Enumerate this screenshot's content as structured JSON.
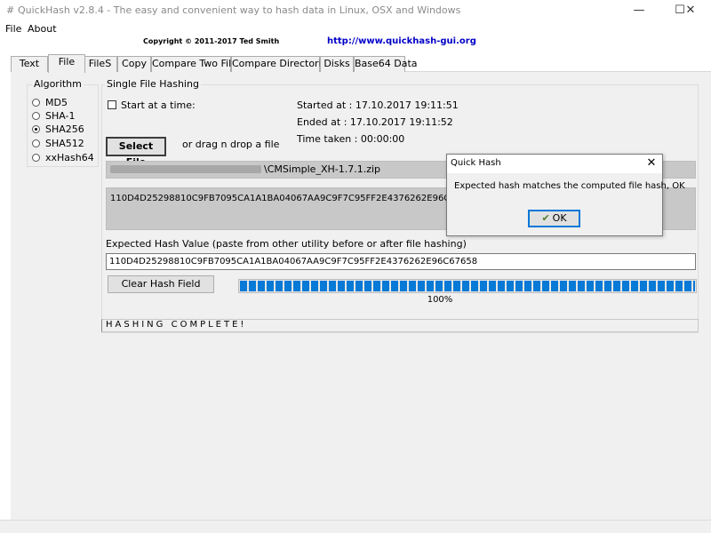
{
  "window": {
    "title": "QuickHash v2.8.4 - The easy and convenient way to hash data in Linux, OSX and Windows",
    "icon": "hash-icon",
    "minimize_glyph": "—",
    "maximize_glyph": "☐",
    "close_glyph": "✕"
  },
  "menu": {
    "items": [
      {
        "label": "File"
      },
      {
        "label": "About"
      }
    ]
  },
  "header": {
    "copyright": "Copyright © 2011-2017 Ted Smith",
    "website": "http://www.quickhash-gui.org"
  },
  "tabs": [
    {
      "label": "Text"
    },
    {
      "label": "File"
    },
    {
      "label": "FileS"
    },
    {
      "label": "Copy"
    },
    {
      "label": "Compare Two Files"
    },
    {
      "label": "Compare Directories"
    },
    {
      "label": "Disks"
    },
    {
      "label": "Base64 Data"
    }
  ],
  "active_tab": "File",
  "algorithm": {
    "legend": "Algorithm",
    "options": [
      {
        "label": "MD5",
        "checked": false
      },
      {
        "label": "SHA-1",
        "checked": false
      },
      {
        "label": "SHA256",
        "checked": true
      },
      {
        "label": "SHA512",
        "checked": false
      },
      {
        "label": "xxHash64",
        "checked": false
      }
    ]
  },
  "single_file": {
    "legend": "Single File Hashing",
    "start_at_label": "Start at a time:",
    "started_at": "Started at : 17.10.2017 19:11:51",
    "ended_at": "Ended at   : 17.10.2017 19:11:52",
    "time_taken": "Time taken : 00:00:00",
    "select_file_label": "Select File",
    "drag_text": "or drag n drop a file",
    "file_path_visible": "\\CMSimple_XH-1.7.1.zip",
    "computed_hash": "110D4D25298810C9FB7095CA1A1BA04067AA9C9F7C95FF2E4376262E96C67658",
    "expected_label": "Expected Hash Value (paste from other utility before or after file hashing)",
    "expected_value": "110D4D25298810C9FB7095CA1A1BA04067AA9C9F7C95FF2E4376262E96C67658",
    "clear_label": "Clear Hash Field",
    "progress_percent": 100,
    "progress_text": "100%",
    "status": "HASHING COMPLETE!"
  },
  "dialog": {
    "title": "Quick Hash",
    "close_glyph": "✕",
    "message": "Expected hash matches the computed file hash, OK",
    "ok_label": "OK",
    "ok_icon": "✔"
  },
  "colors": {
    "progress": "#0779d6",
    "link": "#0000c8",
    "panel": "#f0f0f0"
  }
}
